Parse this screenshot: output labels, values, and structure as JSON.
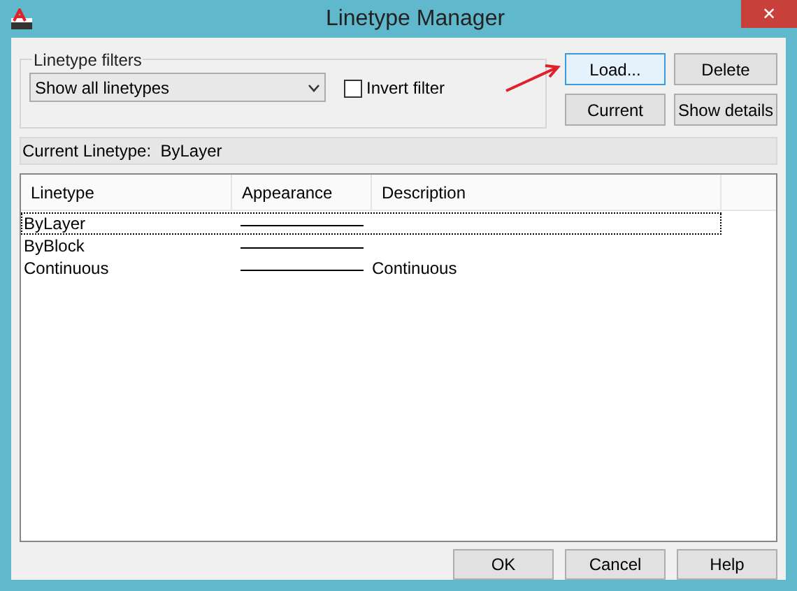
{
  "window": {
    "title": "Linetype Manager",
    "close_glyph": "✕"
  },
  "filters": {
    "label": "Linetype filters",
    "dropdown": "Show all linetypes",
    "invert": {
      "label": "Invert filter",
      "checked": false
    }
  },
  "buttons_top": [
    {
      "label": "Load...",
      "focused": true
    },
    {
      "label": "Delete",
      "focused": false
    },
    {
      "label": "Current",
      "focused": false
    },
    {
      "label": "Show details",
      "focused": false
    }
  ],
  "current_linetype": {
    "label": "Current Linetype:",
    "value": "ByLayer"
  },
  "table": {
    "columns": [
      "Linetype",
      "Appearance",
      "Description"
    ],
    "rows": [
      {
        "linetype": "ByLayer",
        "description": "",
        "selected": true
      },
      {
        "linetype": "ByBlock",
        "description": "",
        "selected": false
      },
      {
        "linetype": "Continuous",
        "description": "Continuous",
        "selected": false
      }
    ]
  },
  "buttons_bottom": [
    "OK",
    "Cancel",
    "Help"
  ]
}
